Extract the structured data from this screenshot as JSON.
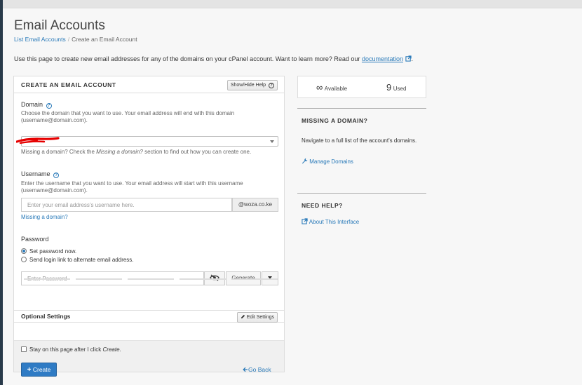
{
  "page": {
    "title": "Email Accounts",
    "breadcrumb": {
      "parent": "List Email Accounts",
      "current": "Create an Email Account"
    },
    "intro_text": "Use this page to create new email addresses for any of the domains on your cPanel account. Want to learn more? Read our",
    "intro_link": "documentation",
    "intro_end": "."
  },
  "form": {
    "header": "CREATE AN EMAIL ACCOUNT",
    "show_hide_help": "Show/Hide Help",
    "domain": {
      "label": "Domain",
      "help_line1": "Choose the domain that you want to use. Your email address will end with this domain",
      "help_line2": "(username@domain.com).",
      "value": "",
      "missing_note": "Missing a domain? Check the ",
      "missing_note_em": "Missing a domain?",
      "missing_note_end": " section to find out how you can create one."
    },
    "username": {
      "label": "Username",
      "help_line1": "Enter the username that you want to use. Your email address will start with this username",
      "help_line2": "(username@domain.com).",
      "placeholder": "Enter your email address's username here.",
      "suffix": "@woza.co.ke",
      "missing_link": "Missing a domain?"
    },
    "password": {
      "label": "Password",
      "option_set": "Set password now.",
      "option_send": "Send login link to alternate email address.",
      "selected_option": "set",
      "placeholder": "Enter Password",
      "generate_label": "Generate"
    },
    "optional": {
      "title": "Optional Settings",
      "edit_label": "Edit Settings"
    },
    "stay_label_prefix": "Stay on this page after I click ",
    "stay_label_em": "Create",
    "stay_label_end": ".",
    "stay_checked": false,
    "create_label": "Create",
    "go_back_label": "Go Back"
  },
  "sidebar": {
    "available_value": "∞",
    "available_label": "Available",
    "used_value": "9",
    "used_label": "Used",
    "missing_domain_title": "MISSING A DOMAIN?",
    "missing_domain_text": "Navigate to a full list of the account's domains.",
    "manage_domains_label": "Manage Domains",
    "need_help_title": "NEED HELP?",
    "about_label": "About This Interface"
  },
  "colors": {
    "accent": "#2a7ab9",
    "primary_button": "#2f7bc4",
    "annotation_red": "#e60000"
  }
}
